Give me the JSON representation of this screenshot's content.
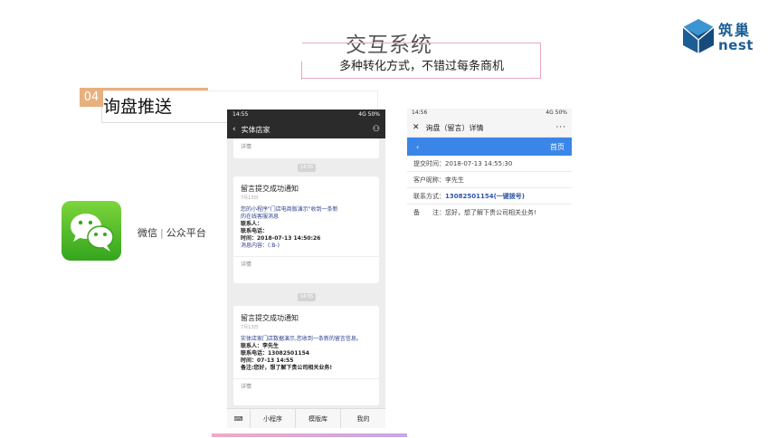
{
  "header": {
    "title": "交互系统",
    "subtitle": "多种转化方式，不错过每条商机"
  },
  "logo": {
    "cn": "筑巢",
    "en": "nest"
  },
  "section": {
    "number": "04",
    "title": "询盘推送"
  },
  "wechat": {
    "label_left": "微信",
    "separator": "|",
    "label_right": "公众平台"
  },
  "phone1": {
    "status_time": "14:55",
    "status_right": "4G 50%",
    "nav_title": "实体店家",
    "top_detail": "详情",
    "ts1": "14:55",
    "card1": {
      "title": "留言提交成功通知",
      "date": "7月13日",
      "lines": [
        "您的小程序\"门店电商版演示\"收到一条新",
        "的在线客服消息",
        "联系人：",
        "联系电话：",
        "时间：2018-07-13 14:50:26",
        "消息内容：(:B-)"
      ],
      "detail": "详情"
    },
    "ts2": "14:55",
    "card2": {
      "title": "留言提交成功通知",
      "date": "7月13日",
      "lines": [
        "实体店家门店数据演示,您收到一条新的留言信息。",
        "联系人：李先生",
        "联系电话：13082501154",
        "时间：07-13 14:55",
        "备注:您好，想了解下贵公司相关业务!"
      ],
      "detail": "详情"
    },
    "bottom_tabs": [
      "小程序",
      "模版库",
      "我的"
    ]
  },
  "phone2": {
    "status_time": "14:56",
    "status_right": "4G 50%",
    "nav_title": "询盘（留言）详情",
    "more": "···",
    "back": "‹",
    "home": "首页",
    "rows": [
      {
        "label": "提交时间：",
        "value": "2018-07-13 14:55:30"
      },
      {
        "label": "客户昵称：",
        "value": "李先生"
      },
      {
        "label": "联系方式：",
        "value": "13082501154",
        "link": "(一键拨号)"
      },
      {
        "label": "备　　注：",
        "value": "您好，想了解下贵公司相关业务!"
      }
    ]
  },
  "colors": {
    "accent_orange": "#e8b07f",
    "accent_pink": "#e7a7c3",
    "brand_blue": "#1d5d96",
    "wechat_green": "#34a51d",
    "header_blue": "#3a86e8"
  }
}
